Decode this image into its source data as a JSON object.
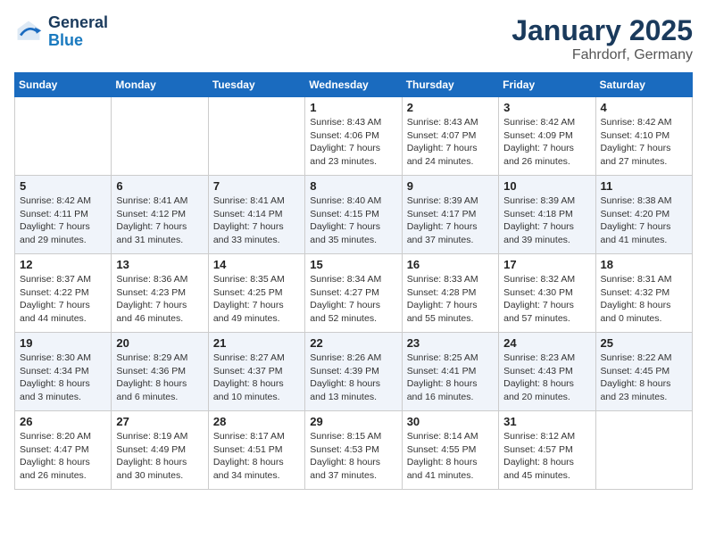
{
  "logo": {
    "line1": "General",
    "line2": "Blue"
  },
  "header": {
    "month": "January 2025",
    "location": "Fahrdorf, Germany"
  },
  "weekdays": [
    "Sunday",
    "Monday",
    "Tuesday",
    "Wednesday",
    "Thursday",
    "Friday",
    "Saturday"
  ],
  "rows": [
    {
      "cells": [
        {
          "day": "",
          "info": ""
        },
        {
          "day": "",
          "info": ""
        },
        {
          "day": "",
          "info": ""
        },
        {
          "day": "1",
          "info": "Sunrise: 8:43 AM\nSunset: 4:06 PM\nDaylight: 7 hours\nand 23 minutes."
        },
        {
          "day": "2",
          "info": "Sunrise: 8:43 AM\nSunset: 4:07 PM\nDaylight: 7 hours\nand 24 minutes."
        },
        {
          "day": "3",
          "info": "Sunrise: 8:42 AM\nSunset: 4:09 PM\nDaylight: 7 hours\nand 26 minutes."
        },
        {
          "day": "4",
          "info": "Sunrise: 8:42 AM\nSunset: 4:10 PM\nDaylight: 7 hours\nand 27 minutes."
        }
      ]
    },
    {
      "cells": [
        {
          "day": "5",
          "info": "Sunrise: 8:42 AM\nSunset: 4:11 PM\nDaylight: 7 hours\nand 29 minutes."
        },
        {
          "day": "6",
          "info": "Sunrise: 8:41 AM\nSunset: 4:12 PM\nDaylight: 7 hours\nand 31 minutes."
        },
        {
          "day": "7",
          "info": "Sunrise: 8:41 AM\nSunset: 4:14 PM\nDaylight: 7 hours\nand 33 minutes."
        },
        {
          "day": "8",
          "info": "Sunrise: 8:40 AM\nSunset: 4:15 PM\nDaylight: 7 hours\nand 35 minutes."
        },
        {
          "day": "9",
          "info": "Sunrise: 8:39 AM\nSunset: 4:17 PM\nDaylight: 7 hours\nand 37 minutes."
        },
        {
          "day": "10",
          "info": "Sunrise: 8:39 AM\nSunset: 4:18 PM\nDaylight: 7 hours\nand 39 minutes."
        },
        {
          "day": "11",
          "info": "Sunrise: 8:38 AM\nSunset: 4:20 PM\nDaylight: 7 hours\nand 41 minutes."
        }
      ]
    },
    {
      "cells": [
        {
          "day": "12",
          "info": "Sunrise: 8:37 AM\nSunset: 4:22 PM\nDaylight: 7 hours\nand 44 minutes."
        },
        {
          "day": "13",
          "info": "Sunrise: 8:36 AM\nSunset: 4:23 PM\nDaylight: 7 hours\nand 46 minutes."
        },
        {
          "day": "14",
          "info": "Sunrise: 8:35 AM\nSunset: 4:25 PM\nDaylight: 7 hours\nand 49 minutes."
        },
        {
          "day": "15",
          "info": "Sunrise: 8:34 AM\nSunset: 4:27 PM\nDaylight: 7 hours\nand 52 minutes."
        },
        {
          "day": "16",
          "info": "Sunrise: 8:33 AM\nSunset: 4:28 PM\nDaylight: 7 hours\nand 55 minutes."
        },
        {
          "day": "17",
          "info": "Sunrise: 8:32 AM\nSunset: 4:30 PM\nDaylight: 7 hours\nand 57 minutes."
        },
        {
          "day": "18",
          "info": "Sunrise: 8:31 AM\nSunset: 4:32 PM\nDaylight: 8 hours\nand 0 minutes."
        }
      ]
    },
    {
      "cells": [
        {
          "day": "19",
          "info": "Sunrise: 8:30 AM\nSunset: 4:34 PM\nDaylight: 8 hours\nand 3 minutes."
        },
        {
          "day": "20",
          "info": "Sunrise: 8:29 AM\nSunset: 4:36 PM\nDaylight: 8 hours\nand 6 minutes."
        },
        {
          "day": "21",
          "info": "Sunrise: 8:27 AM\nSunset: 4:37 PM\nDaylight: 8 hours\nand 10 minutes."
        },
        {
          "day": "22",
          "info": "Sunrise: 8:26 AM\nSunset: 4:39 PM\nDaylight: 8 hours\nand 13 minutes."
        },
        {
          "day": "23",
          "info": "Sunrise: 8:25 AM\nSunset: 4:41 PM\nDaylight: 8 hours\nand 16 minutes."
        },
        {
          "day": "24",
          "info": "Sunrise: 8:23 AM\nSunset: 4:43 PM\nDaylight: 8 hours\nand 20 minutes."
        },
        {
          "day": "25",
          "info": "Sunrise: 8:22 AM\nSunset: 4:45 PM\nDaylight: 8 hours\nand 23 minutes."
        }
      ]
    },
    {
      "cells": [
        {
          "day": "26",
          "info": "Sunrise: 8:20 AM\nSunset: 4:47 PM\nDaylight: 8 hours\nand 26 minutes."
        },
        {
          "day": "27",
          "info": "Sunrise: 8:19 AM\nSunset: 4:49 PM\nDaylight: 8 hours\nand 30 minutes."
        },
        {
          "day": "28",
          "info": "Sunrise: 8:17 AM\nSunset: 4:51 PM\nDaylight: 8 hours\nand 34 minutes."
        },
        {
          "day": "29",
          "info": "Sunrise: 8:15 AM\nSunset: 4:53 PM\nDaylight: 8 hours\nand 37 minutes."
        },
        {
          "day": "30",
          "info": "Sunrise: 8:14 AM\nSunset: 4:55 PM\nDaylight: 8 hours\nand 41 minutes."
        },
        {
          "day": "31",
          "info": "Sunrise: 8:12 AM\nSunset: 4:57 PM\nDaylight: 8 hours\nand 45 minutes."
        },
        {
          "day": "",
          "info": ""
        }
      ]
    }
  ]
}
